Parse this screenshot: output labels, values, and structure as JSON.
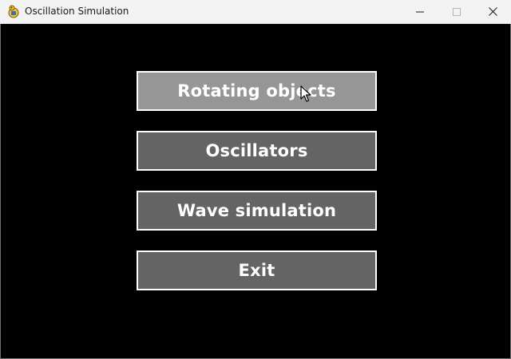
{
  "window": {
    "title": "Oscillation Simulation",
    "app_icon": "pygame-snake-icon"
  },
  "controls": {
    "minimize_icon": "minimize-icon",
    "maximize_icon": "maximize-icon",
    "close_icon": "close-icon"
  },
  "menu": {
    "buttons": [
      {
        "label": "Rotating objects",
        "state": "hover"
      },
      {
        "label": "Oscillators",
        "state": "normal"
      },
      {
        "label": "Wave simulation",
        "state": "normal"
      },
      {
        "label": "Exit",
        "state": "normal"
      }
    ]
  },
  "colors": {
    "background": "#000000",
    "button_normal": "#646464",
    "button_hover": "#969696",
    "button_border": "#ffffff",
    "button_text": "#ffffff"
  }
}
